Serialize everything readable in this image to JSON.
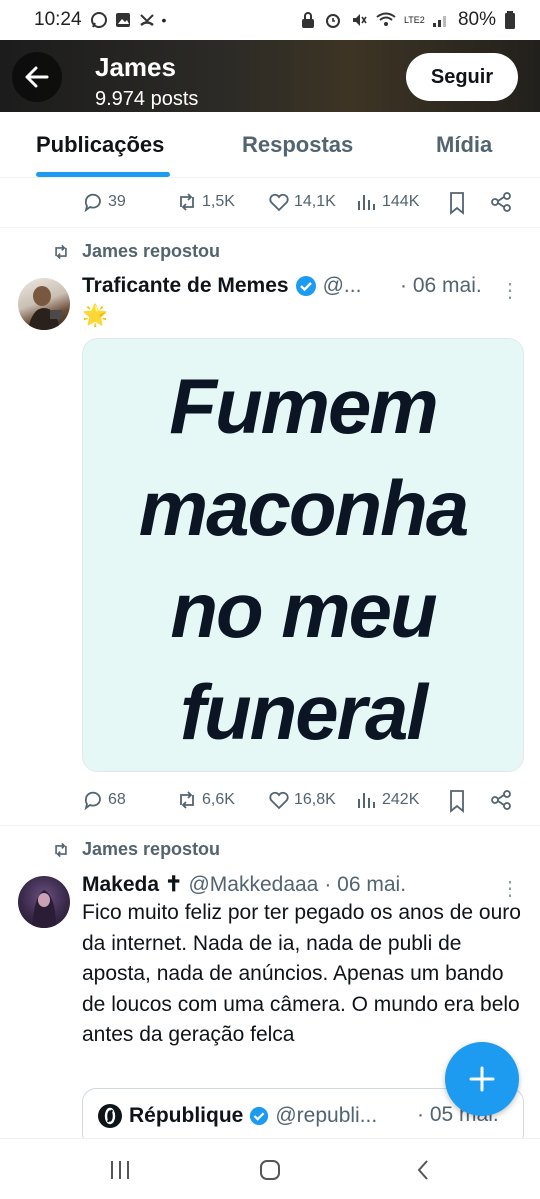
{
  "status_bar": {
    "time": "10:24",
    "battery": "80%",
    "network": "LTE2"
  },
  "profile_header": {
    "name": "James",
    "posts": "9.974 posts",
    "follow_label": "Seguir"
  },
  "tabs": [
    {
      "label": "Publicações",
      "active": true
    },
    {
      "label": "Respostas",
      "active": false
    },
    {
      "label": "Mídia",
      "active": false
    }
  ],
  "post0": {
    "replies": "39",
    "reposts": "1,5K",
    "likes": "14,1K",
    "views": "144K"
  },
  "post1": {
    "repost_label": "James repostou",
    "author": "Traficante de Memes",
    "handle": "@...",
    "date": "· 06 mai.",
    "emoji": "🌟",
    "image_text": [
      "Fumem",
      "maconha",
      "no meu",
      "funeral"
    ],
    "replies": "68",
    "reposts": "6,6K",
    "likes": "16,8K",
    "views": "242K"
  },
  "post2": {
    "repost_label": "James repostou",
    "author": "Makeda ✝",
    "handle": "@Makkedaaa",
    "date": "· 06 mai.",
    "text": "Fico muito feliz por ter pegado os anos de ouro da internet. Nada de ia, nada de publi de aposta, nada de anúncios. Apenas um bando de loucos com uma câmera. O mundo era belo antes da geração felca",
    "quote": {
      "author": "République",
      "handle": "@republi...",
      "date": "· 05 mai."
    }
  },
  "colors": {
    "accent": "#1d9bf0",
    "text": "#0f1419",
    "muted": "#536471"
  }
}
